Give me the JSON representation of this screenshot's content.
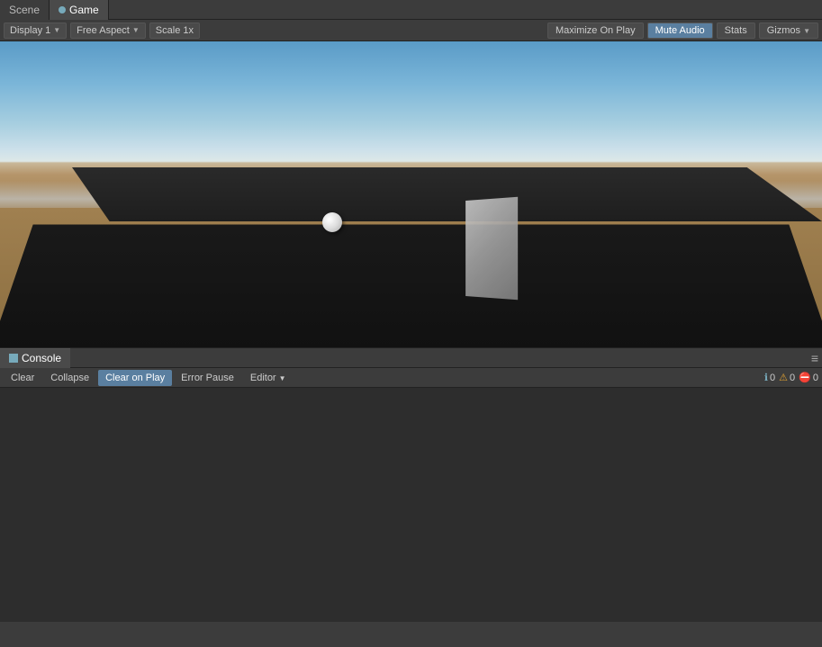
{
  "tabs": {
    "scene": {
      "label": "Scene",
      "icon": "scene-icon"
    },
    "game": {
      "label": "Game",
      "icon": "game-icon",
      "active": true
    }
  },
  "game_toolbar": {
    "display_label": "Display 1",
    "aspect_label": "Free Aspect",
    "scale_label": "Scale",
    "scale_value": "1x",
    "maximize_label": "Maximize On Play",
    "mute_label": "Mute Audio",
    "stats_label": "Stats",
    "gizmos_label": "Gizmos"
  },
  "console": {
    "tab_label": "Console",
    "settings_icon": "≡",
    "toolbar": {
      "clear_label": "Clear",
      "collapse_label": "Collapse",
      "clear_on_play_label": "Clear on Play",
      "error_pause_label": "Error Pause",
      "editor_label": "Editor"
    },
    "counts": {
      "info": "0",
      "warning": "0",
      "error": "0"
    }
  }
}
